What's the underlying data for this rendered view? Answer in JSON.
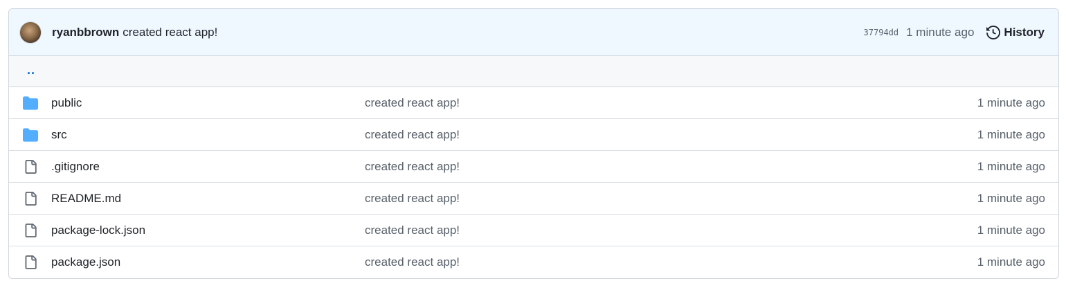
{
  "commit": {
    "author": "ryanbbrown",
    "message": "created react app!",
    "sha": "37794dd",
    "time": "1 minute ago",
    "history_label": "History"
  },
  "parent_dir_label": "..",
  "colors": {
    "folder": "#54aeff",
    "file_icon": "#656d76",
    "link": "#0969da"
  },
  "files": [
    {
      "name": "public",
      "type": "folder",
      "icon": "folder-icon",
      "commit_message": "created react app!",
      "age": "1 minute ago"
    },
    {
      "name": "src",
      "type": "folder",
      "icon": "folder-icon",
      "commit_message": "created react app!",
      "age": "1 minute ago"
    },
    {
      "name": ".gitignore",
      "type": "file",
      "icon": "file-icon",
      "commit_message": "created react app!",
      "age": "1 minute ago"
    },
    {
      "name": "README.md",
      "type": "file",
      "icon": "file-icon",
      "commit_message": "created react app!",
      "age": "1 minute ago"
    },
    {
      "name": "package-lock.json",
      "type": "file",
      "icon": "file-icon",
      "commit_message": "created react app!",
      "age": "1 minute ago"
    },
    {
      "name": "package.json",
      "type": "file",
      "icon": "file-icon",
      "commit_message": "created react app!",
      "age": "1 minute ago"
    }
  ]
}
